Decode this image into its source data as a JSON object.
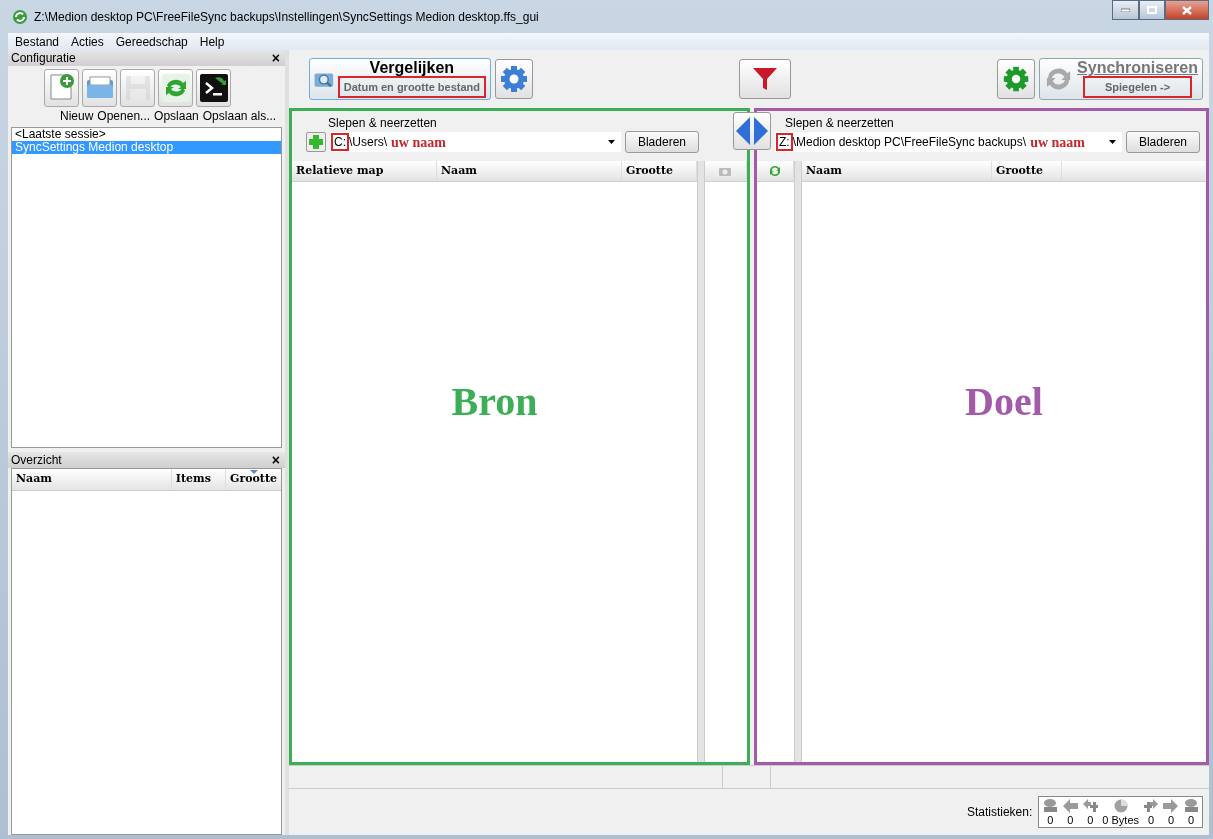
{
  "window": {
    "title": "Z:\\Medion desktop PC\\FreeFileSync backups\\Instellingen\\SyncSettings Medion desktop.ffs_gui"
  },
  "menu": [
    "Bestand",
    "Acties",
    "Gereedschap",
    "Help"
  ],
  "config_panel": {
    "title": "Configuratie",
    "close": "×",
    "tools": [
      {
        "kind": "new",
        "disabled": false
      },
      {
        "kind": "open",
        "disabled": false
      },
      {
        "kind": "save",
        "disabled": true
      },
      {
        "kind": "refresh",
        "disabled": false
      },
      {
        "kind": "batch",
        "disabled": false
      }
    ],
    "tool_labels": [
      "Nieuw",
      "Openen...",
      "Opslaan",
      "Opslaan als..."
    ],
    "sessions": [
      {
        "label": "<Laatste sessie>",
        "selected": false
      },
      {
        "label": "SyncSettings Medion desktop",
        "selected": true
      }
    ]
  },
  "overview_panel": {
    "title": "Overzicht",
    "close": "×",
    "columns": [
      {
        "label": "Naam",
        "sorted": false
      },
      {
        "label": "Items",
        "sorted": false
      },
      {
        "label": "Grootte",
        "sorted": true
      }
    ]
  },
  "toolbar": {
    "compare": {
      "title": "Vergelijken",
      "subtitle": "Datum en grootte bestand",
      "highlighted": true
    },
    "sync": {
      "title": "Synchroniseren",
      "subtitle": "Spiegelen ->",
      "highlighted": true
    }
  },
  "panes": [
    {
      "color": "#3cae55",
      "caption": "Slepen & neerzetten",
      "drive": "C:",
      "drive_highlighted": true,
      "path": "\\Users\\",
      "annotation": "uw naam",
      "browse": "Bladeren",
      "label": "Bron",
      "columns": [
        "Relatieve map",
        "Naam",
        "Grootte"
      ]
    },
    {
      "color": "#a35aa8",
      "caption": "Slepen & neerzetten",
      "drive": "Z:",
      "drive_highlighted": true,
      "path": "\\Medion desktop PC\\FreeFileSync backups\\",
      "annotation": "uw naam",
      "browse": "Bladeren",
      "label": "Doel",
      "columns": [
        "Naam",
        "Grootte"
      ]
    }
  ],
  "statistics": {
    "label": "Statistieken:",
    "items": [
      {
        "kind": "disk",
        "value": "0"
      },
      {
        "kind": "arrow-left",
        "value": "0"
      },
      {
        "kind": "plus-left",
        "value": "0"
      },
      {
        "kind": "pie",
        "value": "0 Bytes"
      },
      {
        "kind": "plus-right",
        "value": "0"
      },
      {
        "kind": "arrow-right",
        "value": "0"
      },
      {
        "kind": "disk",
        "value": "0"
      }
    ]
  }
}
